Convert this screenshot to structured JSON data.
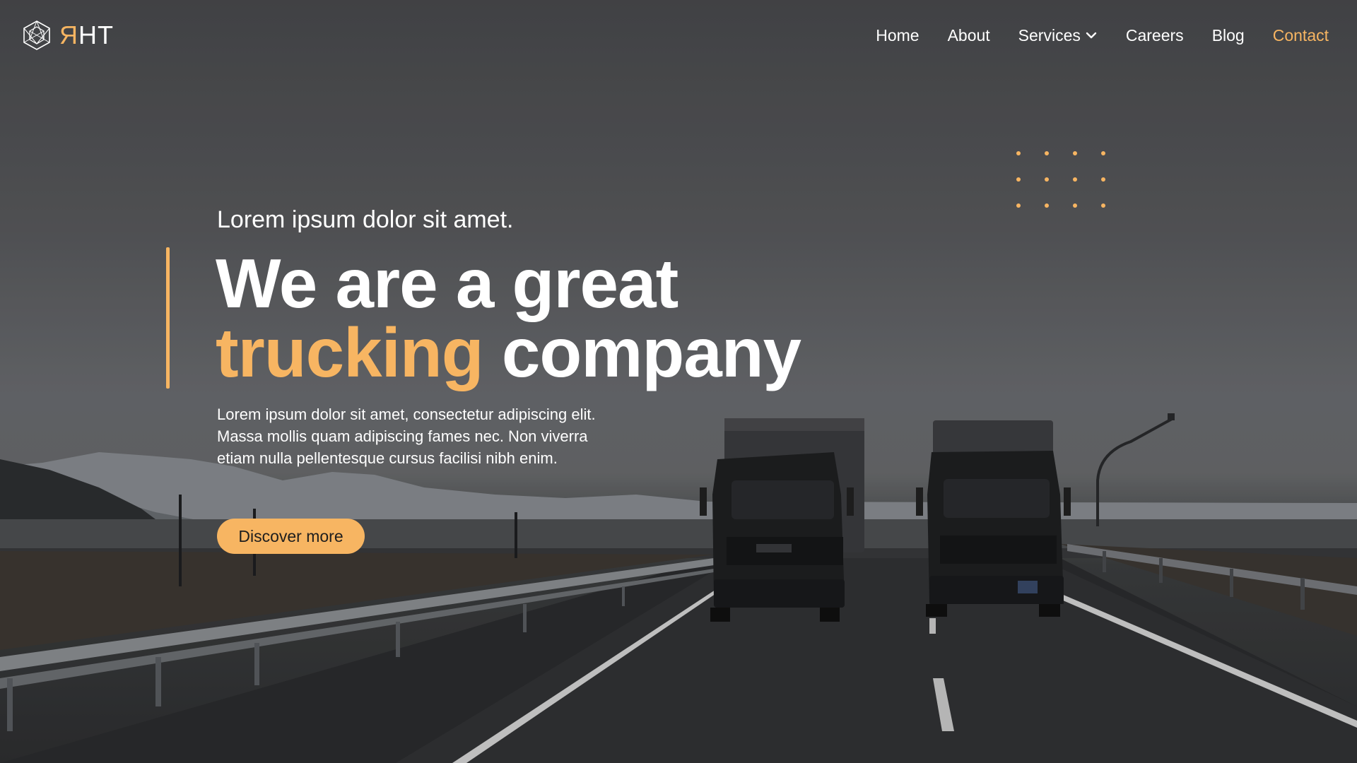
{
  "brand": {
    "logo_icon": "hexagon-cube-icon",
    "name_accent": "Я",
    "name_rest": "HT"
  },
  "nav": {
    "items": [
      {
        "label": "Home"
      },
      {
        "label": "About"
      },
      {
        "label": "Services",
        "icon": "chevron-down-icon"
      },
      {
        "label": "Careers"
      },
      {
        "label": "Blog"
      },
      {
        "label": "Contact",
        "active": true
      }
    ]
  },
  "hero": {
    "eyebrow": "Lorem ipsum dolor sit amet.",
    "headline_line1": "We are a great",
    "headline_highlight": "trucking",
    "headline_rest": "company",
    "description": "Lorem ipsum dolor sit amet, consectetur adipiscing elit. Massa mollis quam adipiscing fames nec. Non viverra etiam nulla pellentesque cursus facilisi nibh enim.",
    "cta_label": "Discover more"
  },
  "colors": {
    "accent": "#f7b562",
    "text": "#ffffff",
    "button_text": "#1e1e1e"
  }
}
